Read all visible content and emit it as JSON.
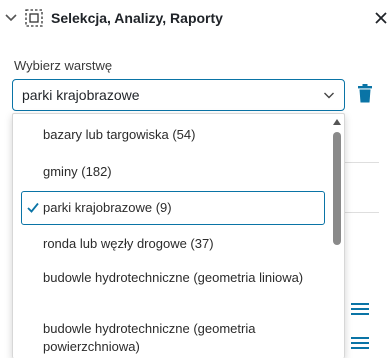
{
  "header": {
    "title": "Selekcja, Analizy, Raporty",
    "collapse_icon": "chevron-down-icon",
    "selection_icon": "selection-box-icon",
    "close_icon": "close-icon"
  },
  "layer_picker": {
    "label": "Wybierz warstwę",
    "selected_value": "parki krajobrazowe",
    "chevron_icon": "chevron-down-icon",
    "delete_icon": "trash-icon"
  },
  "dropdown": {
    "options": [
      {
        "label": "bazary lub targowiska (54)",
        "selected": false
      },
      {
        "label": "gminy (182)",
        "selected": false
      },
      {
        "label": "parki krajobrazowe (9)",
        "selected": true
      },
      {
        "label": "ronda lub węzły drogowe (37)",
        "selected": false
      },
      {
        "label": "budowle hydrotechniczne (geometria liniowa)",
        "selected": false
      },
      {
        "label": "budowle hydrotechniczne (geometria powierzchniowa)",
        "selected": false
      }
    ]
  },
  "side_icons": [
    "menu-icon",
    "menu-icon"
  ],
  "colors": {
    "accent": "#0a74a6",
    "text": "#1f2328",
    "scrollbar": "#8a8a8a"
  }
}
